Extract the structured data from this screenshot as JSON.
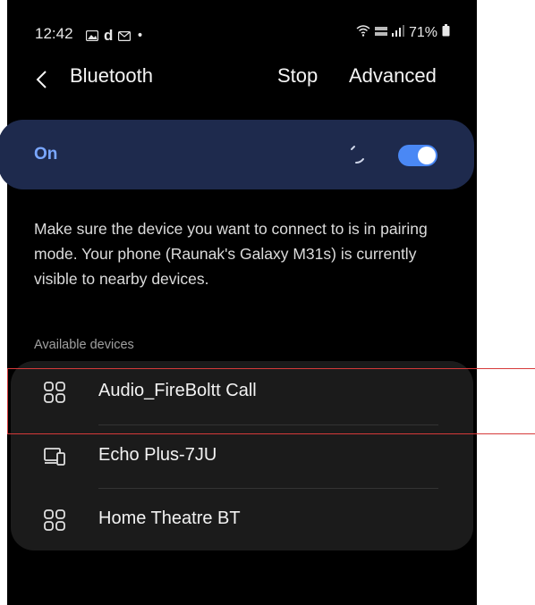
{
  "status_bar": {
    "time": "12:42",
    "letter": "d",
    "dot": "•",
    "battery_percent": "71%"
  },
  "header": {
    "title": "Bluetooth",
    "stop_label": "Stop",
    "advanced_label": "Advanced"
  },
  "bluetooth_toggle": {
    "label": "On",
    "state": true,
    "accent_color": "#4a88f5"
  },
  "description": "Make sure the device you want to connect to is in pairing mode. Your phone (Raunak's Galaxy M31s) is currently visible to nearby devices.",
  "available_devices": {
    "section_label": "Available devices",
    "items": [
      {
        "name": "Audio_FireBoltt Call",
        "icon": "audio-device-icon"
      },
      {
        "name": "Echo Plus-7JU",
        "icon": "computer-device-icon"
      },
      {
        "name": "Home Theatre BT",
        "icon": "audio-device-icon"
      }
    ]
  },
  "highlight_color": "#d63a3a"
}
